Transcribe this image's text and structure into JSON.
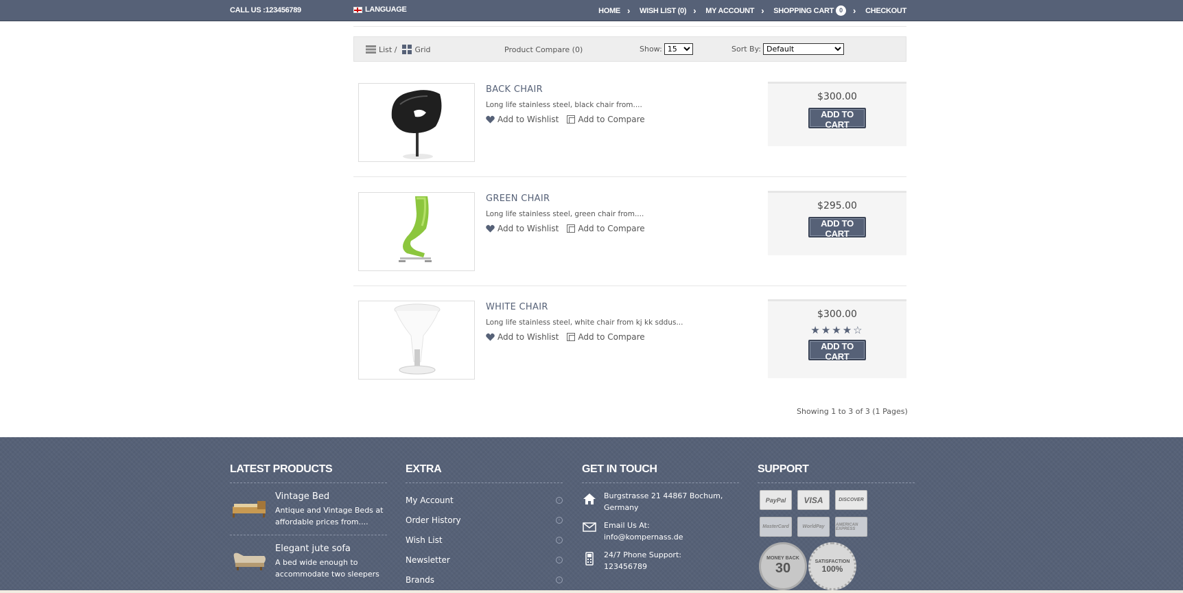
{
  "topbar": {
    "call": "CALL US :123456789",
    "language": "LANGUAGE",
    "nav": [
      {
        "label": "HOME"
      },
      {
        "label": "WISH LIST (0)"
      },
      {
        "label": "MY ACCOUNT"
      },
      {
        "label": "SHOPPING CART",
        "badge": "0"
      },
      {
        "label": "CHECKOUT"
      }
    ]
  },
  "toolbar": {
    "list_label": "List /",
    "grid_label": "Grid",
    "compare_label": "Product Compare (0)",
    "show_label": "Show:",
    "show_value": "15",
    "sort_label": "Sort By:",
    "sort_value": "Default"
  },
  "products": [
    {
      "name": "BACK CHAIR",
      "desc": "Long life stainless steel, black chair from....",
      "wishlist": "Add to Wishlist",
      "compare": "Add to Compare",
      "price": "$300.00",
      "cart": "ADD TO CART",
      "rating": null
    },
    {
      "name": "GREEN CHAIR",
      "desc": "Long life stainless steel, green chair from....",
      "wishlist": "Add to Wishlist",
      "compare": "Add to Compare",
      "price": "$295.00",
      "cart": "ADD TO CART",
      "rating": null
    },
    {
      "name": "WHITE CHAIR",
      "desc": "Long life stainless steel, white chair from kj kk sddus...",
      "wishlist": "Add to Wishlist",
      "compare": "Add to Compare",
      "price": "$300.00",
      "cart": "ADD TO CART",
      "rating": 4,
      "rating_max": 5
    }
  ],
  "pagination": "Showing 1 to 3 of 3 (1 Pages)",
  "footer": {
    "latest": {
      "title": "LATEST PRODUCTS",
      "items": [
        {
          "name": "Vintage Bed",
          "desc": "Antique and Vintage Beds at affordable prices from...."
        },
        {
          "name": "Elegant jute sofa",
          "desc": "A bed wide enough to accommodate two sleepers"
        }
      ]
    },
    "extra": {
      "title": "EXTRA",
      "items": [
        "My Account",
        "Order History",
        "Wish List",
        "Newsletter",
        "Brands"
      ]
    },
    "contact": {
      "title": "GET IN TOUCH",
      "address": "Burgstrasse 21 44867 Bochum, Germany",
      "email_label": "Email Us At:",
      "email": "info@kompernass.de",
      "phone_label": "24/7 Phone Support:",
      "phone": "123456789"
    },
    "support": {
      "title": "SUPPORT",
      "payments_row1": [
        "PayPal",
        "VISA",
        "DISCOVER"
      ],
      "payments_row2": [
        "MasterCard",
        "WorldPay",
        "AMERICAN EXPRESS"
      ],
      "badge1_top": "MONEY BACK",
      "badge1_num": "30",
      "badge2_top": "SATISFACTION",
      "badge2_num": "100%"
    }
  }
}
